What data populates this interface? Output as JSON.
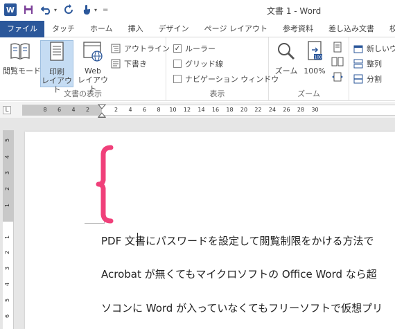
{
  "window": {
    "title": "文書 1 - Word"
  },
  "qat": {
    "logo": "W",
    "icons": [
      "word-logo-icon",
      "save-icon",
      "undo-icon",
      "redo-icon",
      "touch-mode-icon",
      "customize-qat-icon"
    ]
  },
  "tabs": [
    {
      "label": "ファイル",
      "kind": "file"
    },
    {
      "label": "タッチ",
      "kind": "normal"
    },
    {
      "label": "ホーム",
      "kind": "normal"
    },
    {
      "label": "挿入",
      "kind": "normal"
    },
    {
      "label": "デザイン",
      "kind": "normal"
    },
    {
      "label": "ページ レイアウト",
      "kind": "normal"
    },
    {
      "label": "参考資料",
      "kind": "normal"
    },
    {
      "label": "差し込み文書",
      "kind": "normal"
    },
    {
      "label": "校閲",
      "kind": "normal"
    }
  ],
  "ribbon": {
    "views": {
      "label": "文書の表示",
      "read_mode": "閲覧モード",
      "print_layout": "印刷\nレイアウト",
      "web_layout": "Web\nレイアウト",
      "outline": "アウトライン",
      "draft": "下書き"
    },
    "show": {
      "label": "表示",
      "ruler": "ルーラー",
      "ruler_checked": true,
      "gridlines": "グリッド線",
      "gridlines_checked": false,
      "nav_pane": "ナビゲーション ウィンドウ",
      "nav_pane_checked": false
    },
    "zoom": {
      "label": "ズーム",
      "zoom": "ズーム",
      "percent": "100%"
    },
    "window": {
      "new_window": "新しいウ",
      "arrange": "整列",
      "split": "分割"
    }
  },
  "ruler": {
    "corner": "L",
    "left_numbers": [
      "8",
      "6",
      "4",
      "2"
    ],
    "right_numbers": [
      "2",
      "4",
      "6",
      "8",
      "10",
      "12",
      "14",
      "16",
      "18",
      "20",
      "22",
      "24",
      "26",
      "28",
      "30"
    ],
    "vertical_numbers": [
      "5",
      "4",
      "3",
      "2",
      "1",
      "1",
      "2",
      "3",
      "4",
      "5",
      "6"
    ]
  },
  "document": {
    "lines": [
      "PDF 文書にパスワードを設定して閲覧制限をかける方法で",
      "Acrobat が無くてもマイクロソフトの Office Word なら超",
      "ソコンに Word が入っていなくてもフリーソフトで仮想プリ"
    ]
  },
  "colors": {
    "word_blue": "#2b579a",
    "annotation_pink": "#f0407a"
  }
}
